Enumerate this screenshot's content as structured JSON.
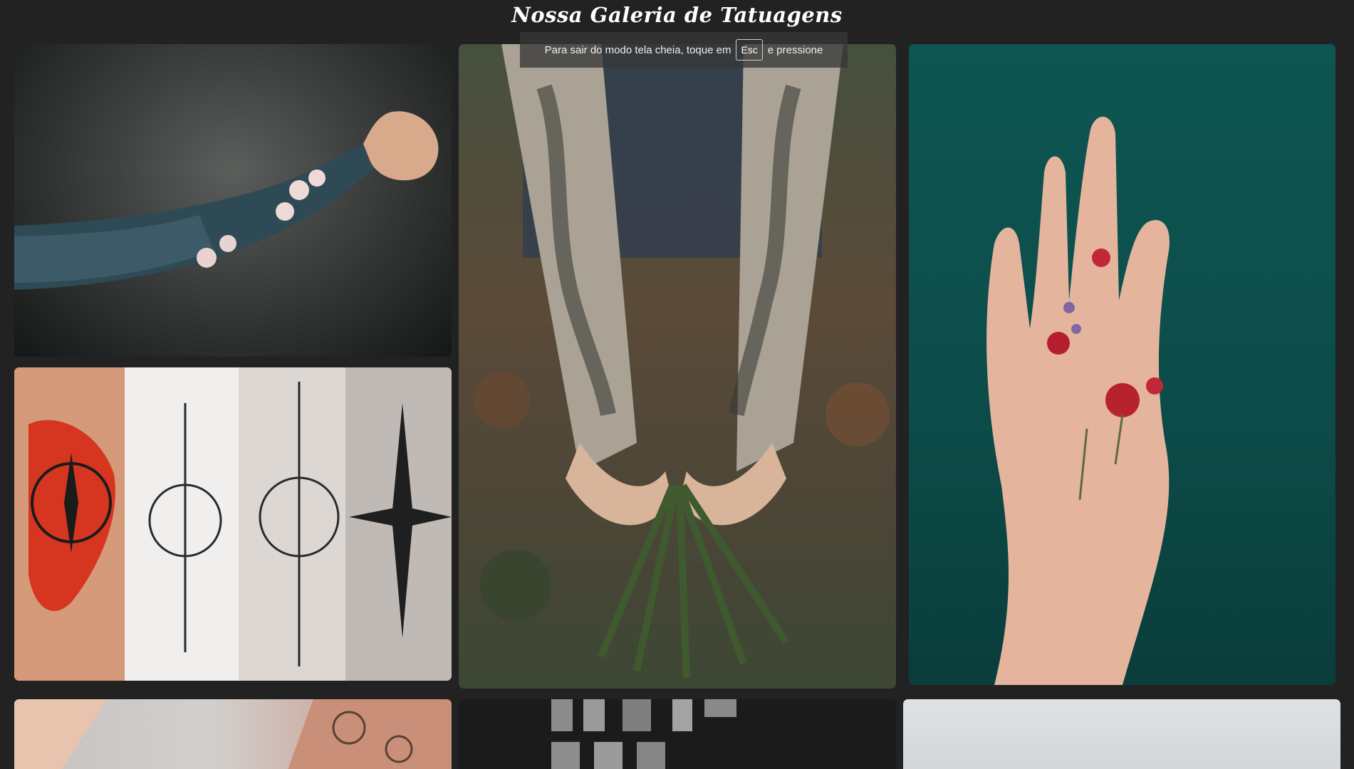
{
  "page": {
    "title": "Nossa Galeria de Tatuagens"
  },
  "fullscreen_notice": {
    "text_before": "Para sair do modo tela cheia, toque em",
    "key": "Esc",
    "text_after": "e pressione"
  },
  "gallery": {
    "items": [
      {
        "subject": "arm-sleeve-tattoo"
      },
      {
        "subject": "compass-tattoos-collage"
      },
      {
        "subject": "tattooed-forearms-holding-plant"
      },
      {
        "subject": "floral-hand-tattoo"
      },
      {
        "subject": "arm-tattoo-partial"
      },
      {
        "subject": "dark-shirt-partial"
      },
      {
        "subject": "light-background-partial"
      }
    ]
  },
  "colors": {
    "background": "#222222",
    "title": "#ffffff",
    "notice_background": "#373737"
  }
}
